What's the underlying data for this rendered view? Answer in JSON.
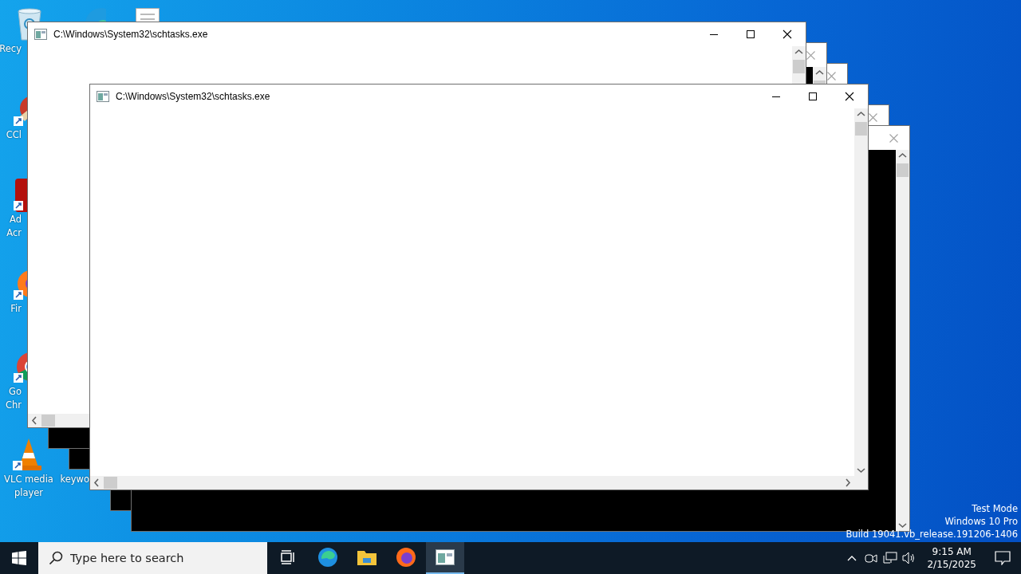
{
  "desktop_icons": [
    {
      "kind": "recycle-bin",
      "lines": [
        "Recy"
      ]
    },
    {
      "kind": "brush",
      "lines": [
        "CCl"
      ]
    },
    {
      "kind": "pdf",
      "lines": [
        "Ad",
        "Acr"
      ]
    },
    {
      "kind": "firefox",
      "lines": [
        "Fir"
      ]
    },
    {
      "kind": "chrome",
      "lines": [
        "Go",
        "Chr"
      ]
    },
    {
      "kind": "vlc",
      "lines": [
        "VLC media",
        "player"
      ]
    },
    {
      "kind": "edge"
    },
    {
      "kind": "file"
    },
    {
      "kind": "none",
      "lines": [
        "keywo"
      ]
    }
  ],
  "windows": [
    {
      "title": "C:\\Windows\\System32\\schtasks.exe",
      "dark": false,
      "dimmed": false
    },
    {
      "dark": true,
      "dimmed": true
    },
    {
      "dark": true,
      "dimmed": true
    },
    {
      "title": "C:\\Windows\\System32\\schtasks.exe",
      "dark": false,
      "dimmed": false
    },
    {
      "dark": true,
      "dimmed": true
    },
    {
      "dark": true,
      "dimmed": true
    }
  ],
  "watermark": [
    "Test Mode",
    "Windows 10 Pro",
    "Build 19041.vb_release.191206-1406"
  ],
  "taskbar": {
    "search": {
      "placeholder": "Type here to search"
    },
    "apps": [
      {
        "kind": "task-view",
        "selected": false
      },
      {
        "kind": "edge",
        "selected": false
      },
      {
        "kind": "explorer",
        "selected": false
      },
      {
        "kind": "firefox",
        "selected": false
      },
      {
        "kind": "console",
        "selected": true
      }
    ],
    "clock": {
      "time": "9:15 AM",
      "date": "2/15/2025"
    }
  }
}
